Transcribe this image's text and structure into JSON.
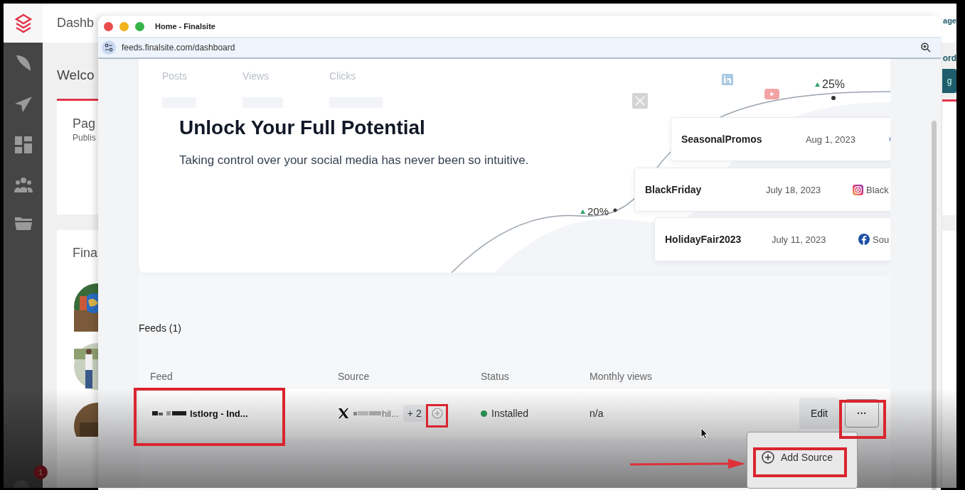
{
  "background_app": {
    "header_title": "Dashb",
    "welcome": "Welco",
    "cards": [
      {
        "title": "Pag",
        "subtitle": "Publis"
      },
      {
        "title": "Fina"
      }
    ],
    "top_link": "age",
    "right_text": "ord",
    "button": "g",
    "notification_count": "1"
  },
  "browser": {
    "title": "Home - Finalsite",
    "url": "feeds.finalsite.com/dashboard"
  },
  "hero": {
    "stats": [
      "Posts",
      "Views",
      "Clicks"
    ],
    "heading": "Unlock Your Full Potential",
    "subtitle": "Taking control over your social media has never been so intuitive.",
    "growth": [
      "25%",
      "20%"
    ],
    "posts": [
      {
        "name": "SeasonalPromos",
        "date": "Aug 1, 2023",
        "kind": "facebook"
      },
      {
        "name": "BlackFriday",
        "date": "July 18, 2023",
        "kind": "instagram",
        "account": "Black"
      },
      {
        "name": "HolidayFair2023",
        "date": "July 11, 2023",
        "kind": "facebook",
        "account": "Sou"
      }
    ]
  },
  "feeds": {
    "title": "Feeds (1)",
    "columns": [
      "Feed",
      "Source",
      "Status",
      "Monthly views"
    ],
    "rows": [
      {
        "name": "lstlorg - Ind...",
        "source": {
          "kind": "x",
          "name": "hil..."
        },
        "extra_sources": "+ 2",
        "status": "Installed",
        "monthly_views": "n/a",
        "edit": "Edit",
        "more": "···",
        "menu_open": true
      }
    ],
    "menu": [
      {
        "label": "Add Source"
      }
    ]
  }
}
